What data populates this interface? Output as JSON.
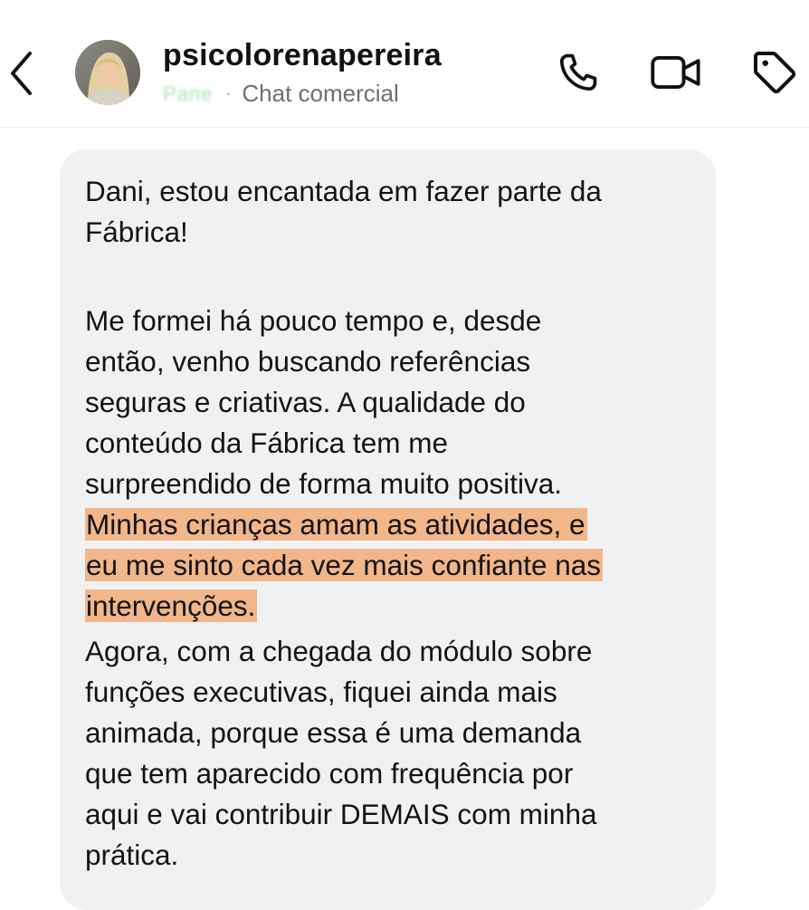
{
  "header": {
    "back_icon": "chevron-left-icon",
    "username": "psicolorenapereira",
    "status_text": "Pane",
    "separator": "·",
    "chat_type": "Chat comercial",
    "icons": [
      "phone-icon",
      "video-camera-icon",
      "tag-icon"
    ]
  },
  "message": {
    "greeting_lines": [
      "Dani, estou encantada em fazer parte da",
      "Fábrica!"
    ],
    "body_lines": [
      "Me formei há pouco tempo e, desde",
      "então, venho buscando referências",
      "seguras e criativas. A qualidade do",
      "conteúdo da Fábrica tem me",
      "surpreendido de forma muito positiva."
    ],
    "highlighted_lines": [
      "Minhas crianças amam as atividades, e",
      "eu me sinto cada vez mais confiante nas",
      "intervenções."
    ],
    "closing_lines": [
      "Agora, com a chegada do módulo sobre",
      "funções executivas, fiquei ainda mais",
      "animada, porque essa é uma demanda",
      "que tem aparecido com frequência por",
      "aqui e vai contribuir DEMAIS com minha",
      "prática."
    ]
  },
  "colors": {
    "bubble": "#eff1f3",
    "highlight": "#f1b68a",
    "text": "#131313",
    "subtext": "#6e6e6e"
  }
}
